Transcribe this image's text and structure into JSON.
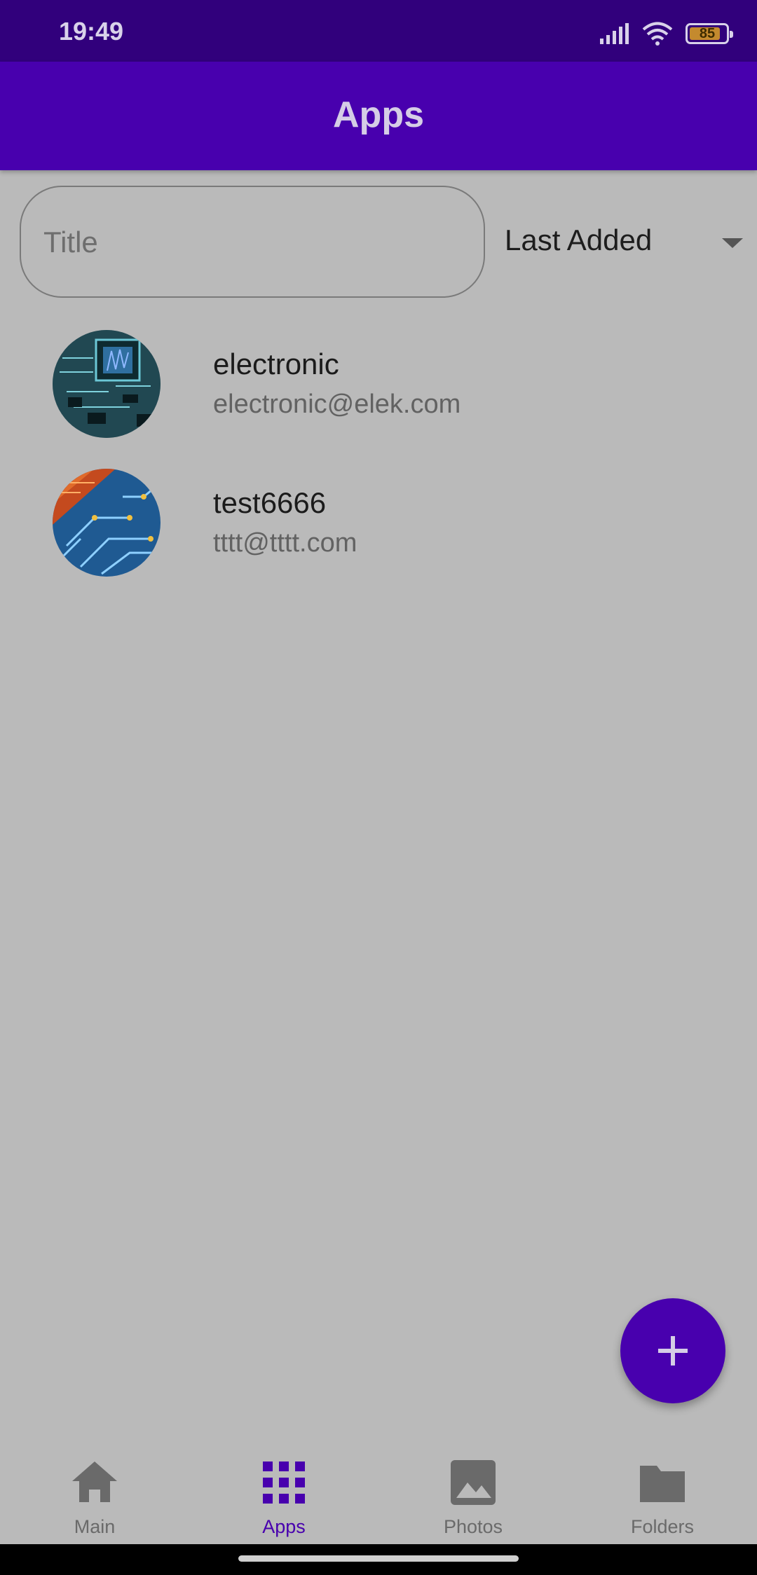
{
  "status_bar": {
    "time": "19:49",
    "battery": "85",
    "battery_level": 0.85
  },
  "app_bar": {
    "title": "Apps"
  },
  "search": {
    "placeholder": "Title",
    "value": ""
  },
  "sort": {
    "selected": "Last Added"
  },
  "apps": [
    {
      "name": "electronic",
      "email": "electronic@elek.com",
      "avatar_icon": "circuit-chip-image"
    },
    {
      "name": "test6666",
      "email": "tttt@tttt.com",
      "avatar_icon": "circuit-board-image"
    }
  ],
  "fab": {
    "icon": "plus-icon"
  },
  "bottom_nav": {
    "items": [
      {
        "label": "Main",
        "icon": "home-icon",
        "active": false
      },
      {
        "label": "Apps",
        "icon": "apps-grid-icon",
        "active": true
      },
      {
        "label": "Photos",
        "icon": "image-icon",
        "active": false
      },
      {
        "label": "Folders",
        "icon": "folder-icon",
        "active": false
      }
    ]
  },
  "colors": {
    "primary": "#4800ae",
    "status_bar": "#31007c",
    "background": "#bababa",
    "inactive_nav": "#6a6a6a"
  }
}
